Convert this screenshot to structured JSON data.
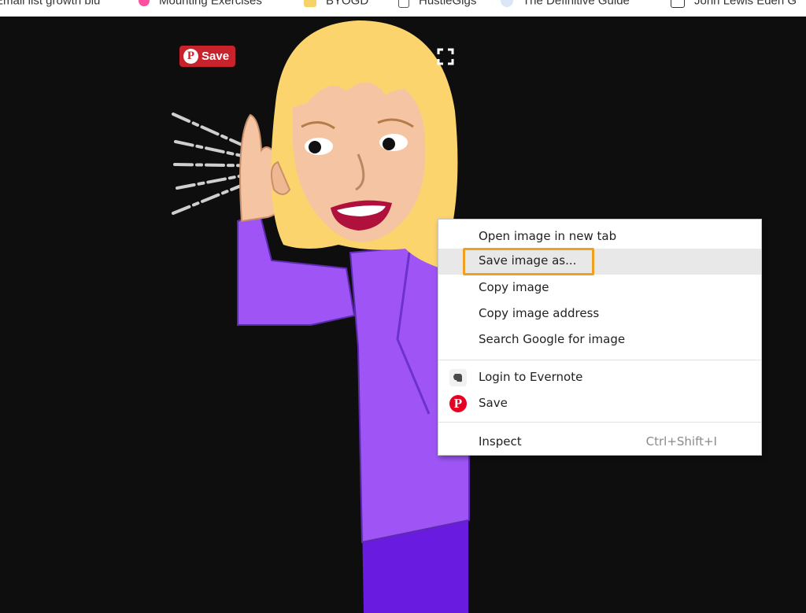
{
  "bookmarks": [
    {
      "label": "Email list growth blu",
      "icon": "page-icon"
    },
    {
      "label": "Mounting Exercises",
      "icon": "flag-icon"
    },
    {
      "label": "BYOGD",
      "icon": "folder-icon"
    },
    {
      "label": "HustleGigs",
      "icon": "page-icon"
    },
    {
      "label": "The Definitive Guide",
      "icon": "globe-icon"
    },
    {
      "label": "John Lewis Eden G",
      "icon": "jl-icon"
    }
  ],
  "pin_save": {
    "label": "Save",
    "logo": "P"
  },
  "context_menu": {
    "items": [
      {
        "label": "Open image in new tab"
      },
      {
        "label": "Save image as..."
      },
      {
        "label": "Copy image"
      },
      {
        "label": "Copy image address"
      },
      {
        "label": "Search Google for image"
      },
      {
        "label": "Login to Evernote",
        "icon": "evernote-icon"
      },
      {
        "label": "Save",
        "icon": "pinterest-icon",
        "icon_glyph": "P"
      },
      {
        "label": "Inspect",
        "shortcut": "Ctrl+Shift+I"
      }
    ],
    "hovered_index": 1
  },
  "colors": {
    "background": "#0e0e0e",
    "pinterest_red": "#c8232c",
    "highlight_border": "#f0a020",
    "hair": "#fbd46d",
    "skin": "#f5c5a3",
    "jacket": "#9f55f5",
    "skirt": "#6a1be0"
  }
}
